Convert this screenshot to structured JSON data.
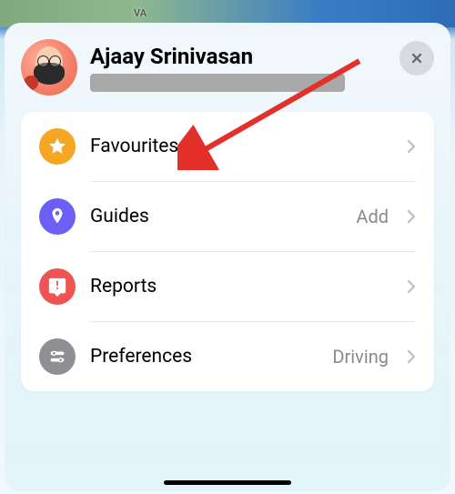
{
  "map": {
    "label": "VA"
  },
  "profile": {
    "name": "Ajaay Srinivasan"
  },
  "close": {
    "label": "Close"
  },
  "menu": {
    "items": [
      {
        "label": "Favourites",
        "aux": "",
        "icon": "star"
      },
      {
        "label": "Guides",
        "aux": "Add",
        "icon": "pin"
      },
      {
        "label": "Reports",
        "aux": "",
        "icon": "exclaim"
      },
      {
        "label": "Preferences",
        "aux": "Driving",
        "icon": "sliders"
      }
    ]
  }
}
